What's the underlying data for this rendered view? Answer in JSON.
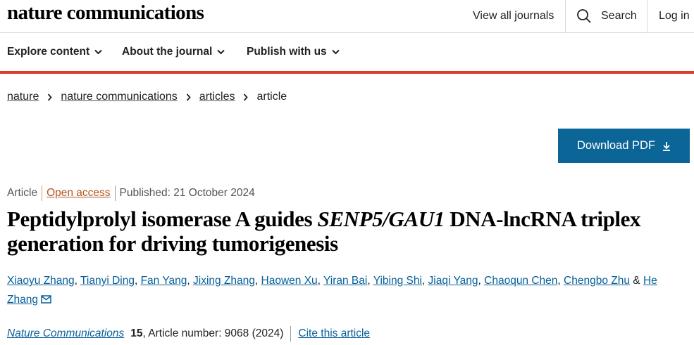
{
  "header": {
    "logo": "nature communications",
    "view_all": "View all journals",
    "search": "Search",
    "login": "Log in"
  },
  "nav": {
    "explore": "Explore content",
    "about": "About the journal",
    "publish": "Publish with us"
  },
  "breadcrumb": {
    "items": [
      "nature",
      "nature communications",
      "articles"
    ],
    "current": "article"
  },
  "download": {
    "label": "Download PDF"
  },
  "article": {
    "type": "Article",
    "access": "Open access",
    "published": "Published: 21 October 2024",
    "title_part1": "Peptidylprolyl isomerase A guides ",
    "title_italic": "SENP5/GAU1",
    "title_part2": " DNA-lncRNA triplex generation for driving tumorigenesis",
    "authors": [
      "Xiaoyu Zhang",
      "Tianyi Ding",
      "Fan Yang",
      "Jixing Zhang",
      "Haowen Xu",
      "Yiran Bai",
      "Yibing Shi",
      "Jiaqi Yang",
      "Chaoqun Chen",
      "Chengbo Zhu",
      "He Zhang"
    ],
    "author_sep": ", ",
    "and": " & "
  },
  "citation": {
    "journal": "Nature Communications",
    "volume": "15",
    "rest": ", Article number: 9068 (2024)",
    "cite": "Cite this article"
  },
  "colors": {
    "accent_red": "#e0392a",
    "button_blue": "#0c6597",
    "link_blue": "#06609a",
    "open_access": "#b3541e"
  }
}
